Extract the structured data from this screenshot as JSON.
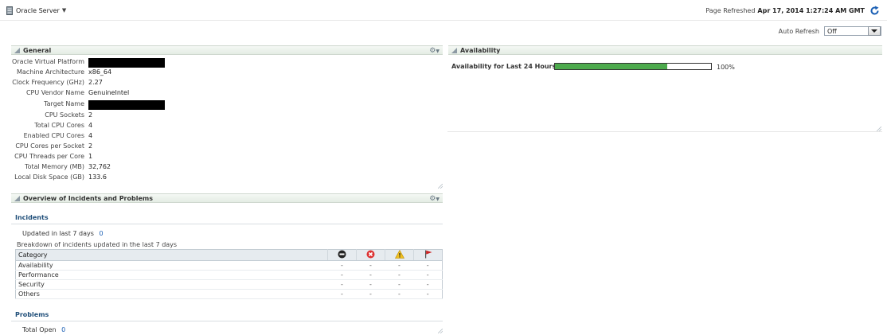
{
  "header": {
    "target_label": "Oracle Server",
    "refreshed_label": "Page Refreshed",
    "refreshed_time": "Apr 17, 2014 1:27:24 AM GMT",
    "auto_refresh_label": "Auto Refresh",
    "auto_refresh_value": "Off"
  },
  "general": {
    "title": "General",
    "rows": [
      {
        "label": "Oracle Virtual Platform",
        "value": "",
        "redacted": true
      },
      {
        "label": "Machine Architecture",
        "value": "x86_64"
      },
      {
        "label": "Clock Frequency (GHz)",
        "value": "2.27"
      },
      {
        "label": "CPU Vendor Name",
        "value": "GenuineIntel"
      },
      {
        "label": "Target Name",
        "value": "",
        "redacted": true
      },
      {
        "label": "CPU Sockets",
        "value": "2"
      },
      {
        "label": "Total CPU Cores",
        "value": "4"
      },
      {
        "label": "Enabled CPU Cores",
        "value": "4"
      },
      {
        "label": "CPU Cores per Socket",
        "value": "2"
      },
      {
        "label": "CPU Threads per Core",
        "value": "1"
      },
      {
        "label": "Total Memory (MB)",
        "value": "32,762"
      },
      {
        "label": "Local Disk Space (GB)",
        "value": "133.6"
      }
    ]
  },
  "availability": {
    "title": "Availability",
    "label": "Availability for Last 24 Hours",
    "fill_fraction": 0.72,
    "value_text": "100%",
    "fill_color": "#4caa4c"
  },
  "overview": {
    "title": "Overview of Incidents and Problems",
    "incidents_header": "Incidents",
    "updated_label": "Updated in last 7 days",
    "updated_value": "0",
    "breakdown_label": "Breakdown of incidents updated in the last 7 days",
    "table": {
      "category_header": "Category",
      "icon_headers": [
        "fatal-icon",
        "critical-icon",
        "warning-icon",
        "escalated-flag-icon"
      ],
      "rows": [
        {
          "category": "Availability",
          "cells": [
            "-",
            "-",
            "-",
            "-"
          ]
        },
        {
          "category": "Performance",
          "cells": [
            "-",
            "-",
            "-",
            "-"
          ]
        },
        {
          "category": "Security",
          "cells": [
            "-",
            "-",
            "-",
            "-"
          ]
        },
        {
          "category": "Others",
          "cells": [
            "-",
            "-",
            "-",
            "-"
          ]
        }
      ]
    },
    "problems_header": "Problems",
    "total_open_label": "Total Open",
    "total_open_value": "0"
  },
  "colors": {
    "link": "#1a5fb4",
    "section_header": "#1f4e79",
    "refresh_icon": "#1a5fb4"
  }
}
